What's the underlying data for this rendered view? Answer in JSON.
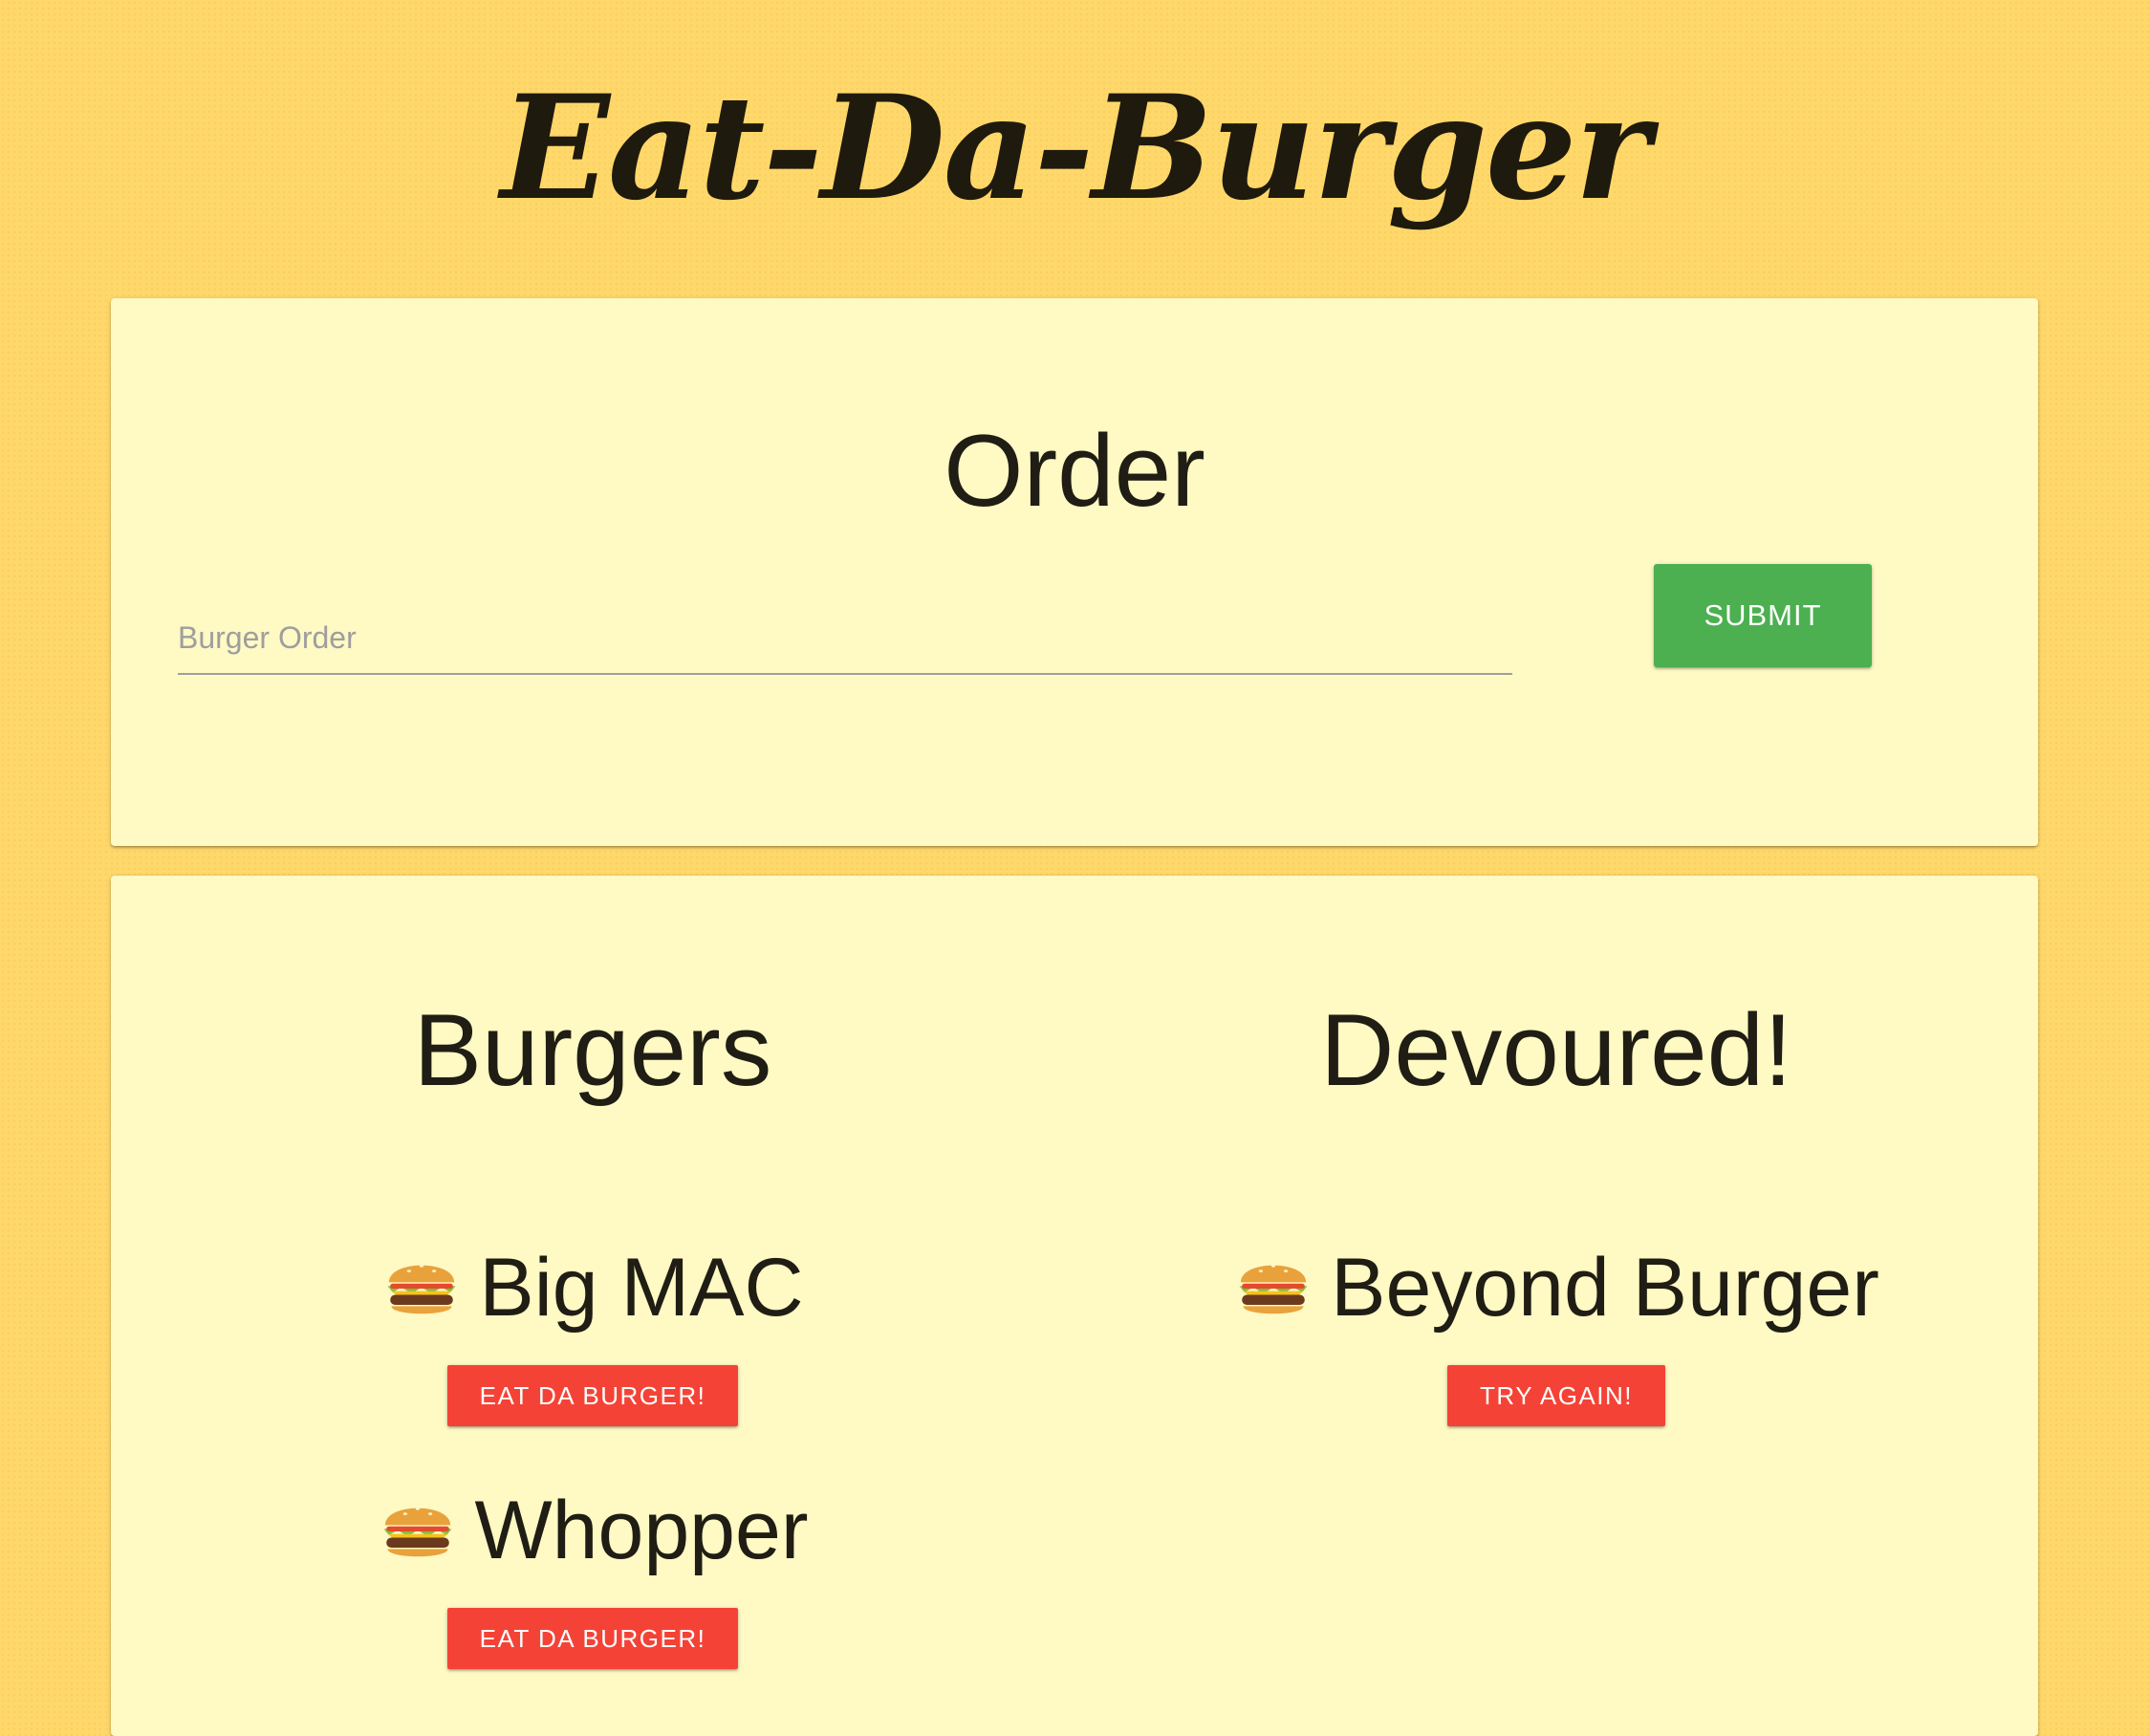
{
  "header": {
    "title": "Eat-Da-Burger"
  },
  "order": {
    "title": "Order",
    "input_placeholder": "Burger Order",
    "input_value": "",
    "submit_label": "SUBMIT"
  },
  "burgers": {
    "title": "Burgers",
    "items": [
      {
        "name": "Big MAC",
        "button_label": "EAT DA BURGER!",
        "icon": "burger-icon"
      },
      {
        "name": "Whopper",
        "button_label": "EAT DA BURGER!",
        "icon": "burger-icon"
      }
    ]
  },
  "devoured": {
    "title": "Devoured!",
    "items": [
      {
        "name": "Beyond Burger",
        "button_label": "TRY AGAIN!",
        "icon": "burger-icon"
      }
    ]
  },
  "colors": {
    "background": "#ffd86b",
    "card": "#fff9c4",
    "submit_button": "#4caf50",
    "item_button": "#f44336"
  }
}
